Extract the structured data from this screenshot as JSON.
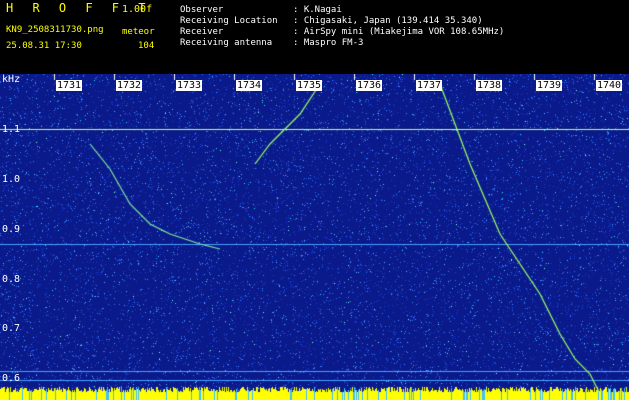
{
  "header": {
    "logo": "H R O F F T",
    "version": "1.00f",
    "filename": "KN9_2508311730.png",
    "mode": "meteor",
    "datetime": "25.08.31 17:30",
    "count": "104",
    "fields": [
      {
        "label": "Observer",
        "value": ": K.Nagai"
      },
      {
        "label": "Receiving Location",
        "value": ": Chigasaki, Japan (139.414 35.340)"
      },
      {
        "label": "Receiver",
        "value": ": AirSpy mini (Miakejima VOR 108.65MHz)"
      },
      {
        "label": "Receiving antenna",
        "value": ": Maspro FM-3"
      }
    ]
  },
  "spectrogram": {
    "unit": "kHz",
    "y_ticks": [
      "1.1",
      "1.0",
      "0.9",
      "0.8",
      "0.7",
      "0.6"
    ],
    "x_ticks": [
      "1731",
      "1732",
      "1733",
      "1734",
      "1735",
      "1736",
      "1737",
      "1738",
      "1739",
      "1740"
    ],
    "colors": {
      "background": "#0a1a8a",
      "noise": "#2f6cff",
      "signal": "#ffff00",
      "line": "#c8ff66"
    }
  }
}
